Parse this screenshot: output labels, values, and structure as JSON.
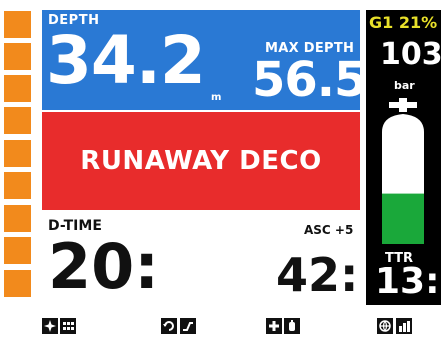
{
  "depth": {
    "label": "DEPTH",
    "value": "34.2",
    "unit": "m"
  },
  "max_depth": {
    "label": "MAX DEPTH",
    "value": "56.5"
  },
  "alarm": {
    "text": "RUNAWAY DECO"
  },
  "dive_time": {
    "label": "D-TIME",
    "value": "20:"
  },
  "ascent": {
    "label": "ASC +5",
    "value": "42:"
  },
  "gas": {
    "label": "G1 21%",
    "pressure": "103",
    "pressure_unit": "bar",
    "cylinder_fill_fraction": 0.45
  },
  "ttr": {
    "label": "TTR",
    "value": "13:"
  },
  "segment_bar": {
    "segments": 9
  },
  "toolbar": {
    "icons": [
      "compass-icon",
      "grid-icon",
      "refresh-icon",
      "graph-icon",
      "plus-icon",
      "tank-icon",
      "globe-icon",
      "bar-chart-icon"
    ]
  },
  "colors": {
    "depth_panel": "#2a79d4",
    "alarm_panel": "#e82c2c",
    "segment": "#f28a1c",
    "gas_label": "#e8e02a",
    "cylinder_fill": "#1aa83a",
    "cylinder_empty": "#ffffff"
  }
}
